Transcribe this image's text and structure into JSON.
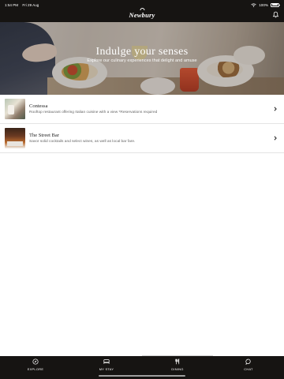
{
  "status_bar": {
    "time": "1:54 PM",
    "date": "Fri 29 Aug",
    "battery": "100%",
    "battery_level": 1.0
  },
  "header": {
    "logo_text": "Newbury",
    "icons": {
      "notification": "bell-icon",
      "wifi": "wifi-icon",
      "battery": "battery-icon"
    }
  },
  "hero": {
    "title": "Indulge your senses",
    "subtitle": "Explore our culinary experiences that delight and amuse"
  },
  "venues": [
    {
      "name": "Contessa",
      "description": "Rooftop restaurant offering Italian cuisine with a view *Reservations required"
    },
    {
      "name": "The Street Bar",
      "description": "Savor solid cocktails and select wines, as well as local bar fare."
    }
  ],
  "tab_bar": {
    "tabs": [
      {
        "label": "EXPLORE",
        "icon": "compass-icon"
      },
      {
        "label": "MY STAY",
        "icon": "bed-icon"
      },
      {
        "label": "DINING",
        "icon": "fork-knife-icon"
      },
      {
        "label": "CHAT",
        "icon": "chat-bubble-icon"
      }
    ]
  },
  "colors": {
    "bar_background": "#161412",
    "text_primary": "#222222",
    "text_secondary": "#666666",
    "divider": "#e4e4e4"
  }
}
